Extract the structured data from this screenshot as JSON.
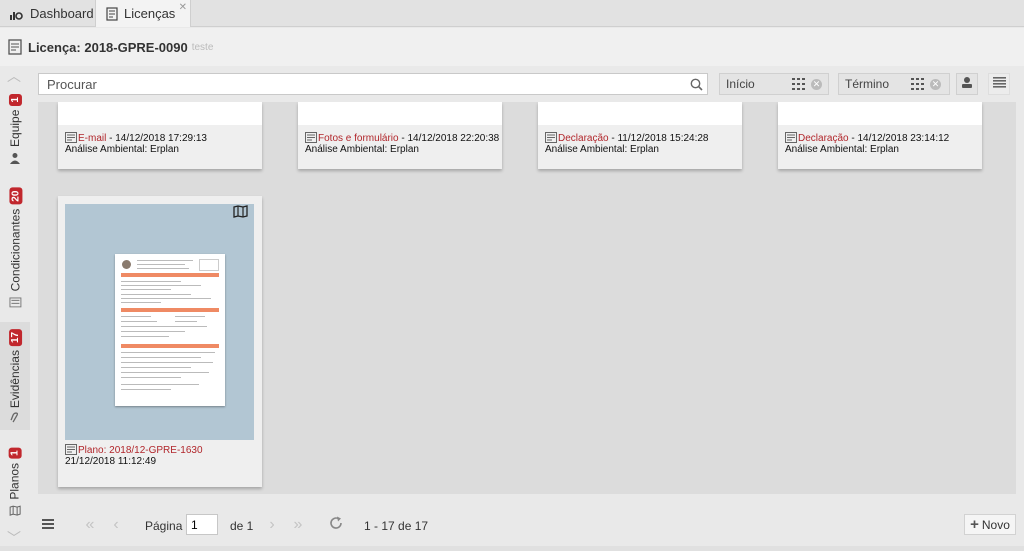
{
  "tabs": [
    {
      "label": "Dashboard",
      "icon": "bar-chart-icon"
    },
    {
      "label": "Licenças",
      "icon": "license-doc-icon"
    }
  ],
  "header": {
    "title": "Licença: 2018-GPRE-0090",
    "subtitle": "teste"
  },
  "side_tabs": [
    {
      "label": "Equipe",
      "count": "1",
      "icon": "team-icon"
    },
    {
      "label": "Condicionantes",
      "count": "20",
      "icon": "condition-icon"
    },
    {
      "label": "Evidências",
      "count": "17",
      "icon": "paperclip-icon"
    },
    {
      "label": "Planos",
      "count": "1",
      "icon": "map-icon"
    }
  ],
  "toolbar": {
    "search_placeholder": "Procurar",
    "start_placeholder": "Início",
    "end_placeholder": "Término"
  },
  "cards": [
    {
      "type": "E-mail",
      "datetime": " - 14/12/2018 17:29:13",
      "subtitle": "Análise Ambiental: Erplan"
    },
    {
      "type": "Fotos e formulário",
      "datetime": " - 14/12/2018 22:20:38",
      "subtitle": "Análise Ambiental: Erplan"
    },
    {
      "type": "Declaração",
      "datetime": " - 11/12/2018 15:24:28",
      "subtitle": "Análise Ambiental: Erplan"
    },
    {
      "type": "Declaração",
      "datetime": " - 14/12/2018 23:14:12",
      "subtitle": "Análise Ambiental: Erplan"
    },
    {
      "type": "Plano: 2018/12-GPRE-1630",
      "datetime": "",
      "subtitle": "21/12/2018 11:12:49"
    }
  ],
  "pager": {
    "page_label": "Página",
    "page_value": "1",
    "of_label": "de 1",
    "range": "1 - 17 de 17",
    "new_label": "Novo"
  },
  "colors": {
    "accent_red": "#b1262b",
    "badge_red": "#c1272d",
    "preview_blue": "#b2c6d3"
  }
}
